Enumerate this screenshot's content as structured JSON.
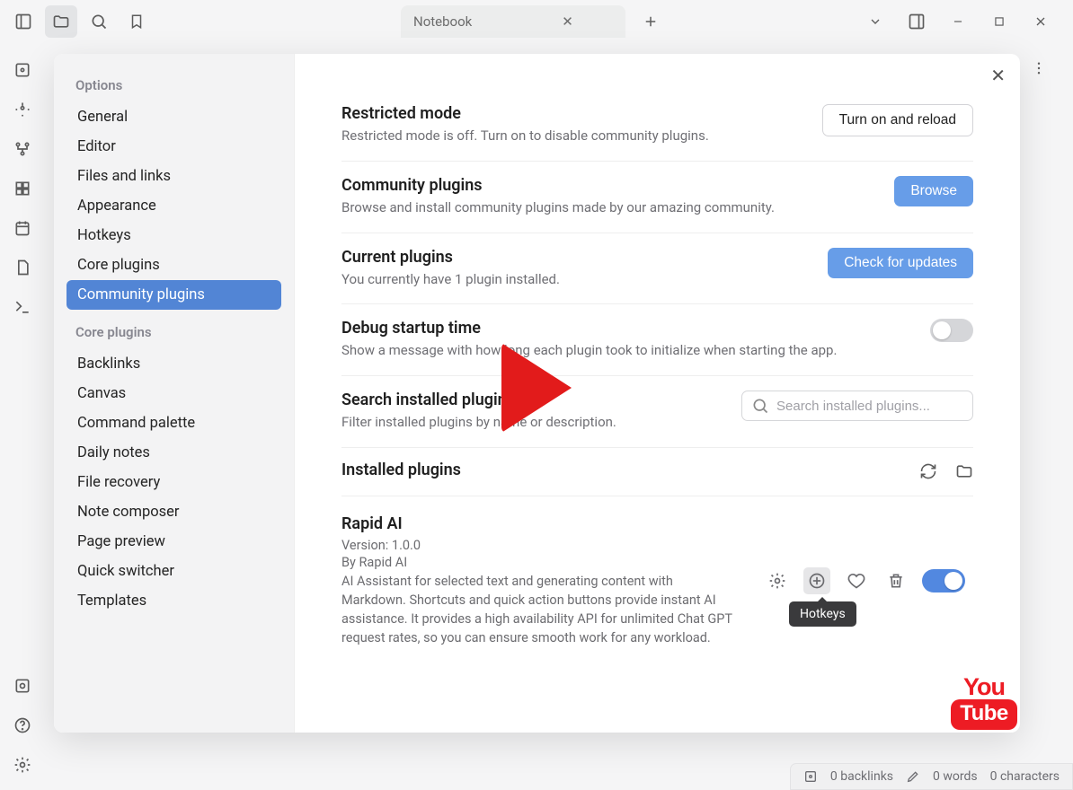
{
  "titlebar": {
    "tab_name": "Notebook"
  },
  "sidebar": {
    "options_header": "Options",
    "options": [
      "General",
      "Editor",
      "Files and links",
      "Appearance",
      "Hotkeys",
      "Core plugins",
      "Community plugins"
    ],
    "selected_option": "Community plugins",
    "core_header": "Core plugins",
    "core": [
      "Backlinks",
      "Canvas",
      "Command palette",
      "Daily notes",
      "File recovery",
      "Note composer",
      "Page preview",
      "Quick switcher",
      "Templates"
    ]
  },
  "settings": {
    "restricted": {
      "title": "Restricted mode",
      "desc": "Restricted mode is off. Turn on to disable community plugins.",
      "button": "Turn on and reload"
    },
    "community": {
      "title": "Community plugins",
      "desc": "Browse and install community plugins made by our amazing community.",
      "button": "Browse"
    },
    "current": {
      "title": "Current plugins",
      "desc": "You currently have 1 plugin installed.",
      "button": "Check for updates"
    },
    "debug": {
      "title": "Debug startup time",
      "desc": "Show a message with how long each plugin took to initialize when starting the app."
    },
    "search": {
      "title": "Search installed plugins",
      "desc": "Filter installed plugins by name or description.",
      "placeholder": "Search installed plugins..."
    },
    "installed_header": "Installed plugins",
    "plugin": {
      "name": "Rapid AI",
      "version_label": "Version: 1.0.0",
      "author": "By Rapid AI",
      "desc": "AI Assistant for selected text and generating content with Markdown. Shortcuts and quick action buttons provide instant AI assistance. It provides a high availability API for unlimited Chat GPT request rates, so you can ensure smooth work for any workload.",
      "tooltip": "Hotkeys"
    }
  },
  "statusbar": {
    "backlinks": "0 backlinks",
    "words": "0 words",
    "characters": "0 characters"
  },
  "youtube": {
    "top": "You",
    "bottom": "Tube"
  }
}
